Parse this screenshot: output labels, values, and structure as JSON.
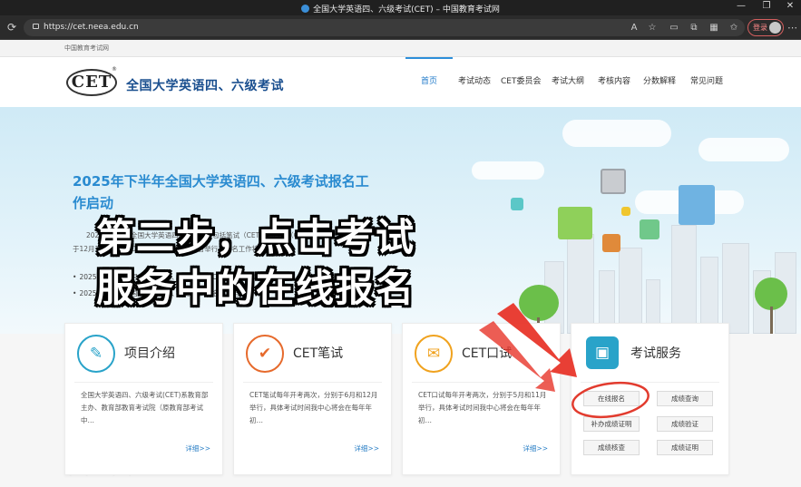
{
  "window": {
    "title": "全国大学英语四、六级考试(CET) – 中国教育考试网",
    "controls": [
      "—",
      "❐",
      "✕"
    ]
  },
  "browser": {
    "url": "https://cet.neea.edu.cn",
    "login_label": "登录",
    "more_label": "⋯"
  },
  "site": {
    "top_strip": "中国教育考试网",
    "logo_text": "CET",
    "logo_mark": "®",
    "name": "全国大学英语四、六级考试",
    "nav": [
      "首页",
      "考试动态",
      "CET委员会",
      "考试大纲",
      "考核内容",
      "分数解释",
      "常见问题"
    ],
    "active_nav_index": 0
  },
  "banner": {
    "title": "2025年下半年全国大学英语四、六级考试报名工作启动",
    "text": "2025年下半年全国大学英语四、六级考试包括笔试（CET）和口试（CET-SET），笔试将于12月13日举行，口试将于11月22至23日举行。报名工作将于",
    "items": [
      "2025年下半年全国大学英语四、六级考试（CET）成绩查询",
      "2025年下半年全国大学英语四、六级考试报名工作启动"
    ]
  },
  "overlay_caption": {
    "line1": "第二步，点击考试",
    "line2": "服务中的在线报名"
  },
  "cards": [
    {
      "title": "项目介绍",
      "text": "全国大学英语四、六级考试(CET)系教育部主办、教育部教育考试院（原教育部考试中…",
      "more": "详细>>",
      "icon": "document-icon"
    },
    {
      "title": "CET笔试",
      "text": "CET笔试每年开考两次，分别于6月和12月举行，具体考试时间我中心将会在每年年初…",
      "more": "详细>>",
      "icon": "checkmark-icon"
    },
    {
      "title": "CET口试",
      "text": "CET口试每年开考两次，分别于5月和11月举行，具体考试时间我中心将会在每年年初…",
      "more": "详细>>",
      "icon": "ticket-icon"
    },
    {
      "title": "考试服务",
      "icon": "user-card-icon"
    }
  ],
  "services": {
    "buttons": [
      "在线报名",
      "成绩查询",
      "补办成绩证明",
      "成绩验证",
      "成绩核查",
      "成绩证明"
    ]
  },
  "colors": {
    "brand_blue": "#2a8bd0",
    "nav_active": "#1d78c8",
    "arrow_red": "#e8362b",
    "card_orange": "#e66a2c",
    "card_yellow": "#f0a21e",
    "card_teal": "#29a3c9"
  }
}
